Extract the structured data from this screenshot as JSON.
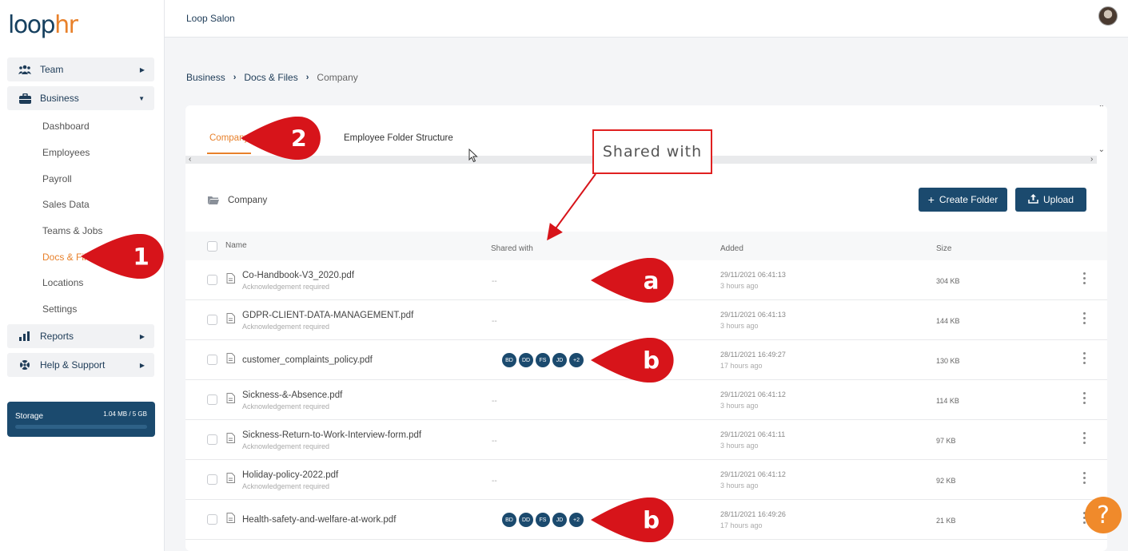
{
  "app": {
    "logo_loop": "loop",
    "logo_hr": "hr",
    "topbar_title": "Loop Salon"
  },
  "sidebar": {
    "groups": [
      {
        "label": "Team",
        "icon": "team-icon",
        "arrow": "▶"
      },
      {
        "label": "Business",
        "icon": "briefcase-icon",
        "arrow": "▼"
      },
      {
        "label": "Reports",
        "icon": "bar-chart-icon",
        "arrow": "▶"
      },
      {
        "label": "Help & Support",
        "icon": "lifebuoy-icon",
        "arrow": "▶"
      }
    ],
    "business_items": [
      "Dashboard",
      "Employees",
      "Payroll",
      "Sales Data",
      "Teams & Jobs",
      "Docs & Files",
      "Locations",
      "Settings"
    ],
    "active_item": "Docs & Files",
    "storage": {
      "label": "Storage",
      "value": "1.04 MB / 5 GB",
      "used_fraction": 0.0002
    }
  },
  "breadcrumb": {
    "items": [
      "Business",
      "Docs & Files",
      "Company"
    ],
    "separator": "›"
  },
  "tabs": [
    {
      "label": "Company",
      "active": true
    },
    {
      "label": "Employee Folder Structure",
      "active": false
    }
  ],
  "folder": {
    "name": "Company",
    "create_button": "Create Folder",
    "upload_button": "Upload"
  },
  "table": {
    "headers": {
      "name": "Name",
      "shared": "Shared with",
      "added": "Added",
      "size": "Size"
    },
    "rows": [
      {
        "name": "Co-Handbook-V3_2020.pdf",
        "sub": "Acknowledgement required",
        "shared": "--",
        "chips": [],
        "added": "29/11/2021 06:41:13",
        "ago": "3 hours ago",
        "size": "304 KB"
      },
      {
        "name": "GDPR-CLIENT-DATA-MANAGEMENT.pdf",
        "sub": "Acknowledgement required",
        "shared": "--",
        "chips": [],
        "added": "29/11/2021 06:41:13",
        "ago": "3 hours ago",
        "size": "144 KB"
      },
      {
        "name": "customer_complaints_policy.pdf",
        "sub": "",
        "shared": "",
        "chips": [
          "BD",
          "DD",
          "FS",
          "JD",
          "+2"
        ],
        "added": "28/11/2021 16:49:27",
        "ago": "17 hours ago",
        "size": "130 KB"
      },
      {
        "name": "Sickness-&-Absence.pdf",
        "sub": "Acknowledgement required",
        "shared": "--",
        "chips": [],
        "added": "29/11/2021 06:41:12",
        "ago": "3 hours ago",
        "size": "114 KB"
      },
      {
        "name": "Sickness-Return-to-Work-Interview-form.pdf",
        "sub": "Acknowledgement required",
        "shared": "--",
        "chips": [],
        "added": "29/11/2021 06:41:11",
        "ago": "3 hours ago",
        "size": "97 KB"
      },
      {
        "name": "Holiday-policy-2022.pdf",
        "sub": "Acknowledgement required",
        "shared": "--",
        "chips": [],
        "added": "29/11/2021 06:41:12",
        "ago": "3 hours ago",
        "size": "92 KB"
      },
      {
        "name": "Health-safety-and-welfare-at-work.pdf",
        "sub": "",
        "shared": "",
        "chips": [
          "BD",
          "DD",
          "FS",
          "JD",
          "+2"
        ],
        "added": "28/11/2021 16:49:26",
        "ago": "17 hours ago",
        "size": "21 KB"
      }
    ]
  },
  "annotations": {
    "marker_1": "1",
    "marker_2": "2",
    "marker_a": "a",
    "marker_b1": "b",
    "marker_b2": "b",
    "shared_callout": "Shared with",
    "color": "#d7141a"
  },
  "help_button": "?",
  "colors": {
    "brand_navy": "#1b4a6e",
    "accent_orange": "#e8812b"
  }
}
